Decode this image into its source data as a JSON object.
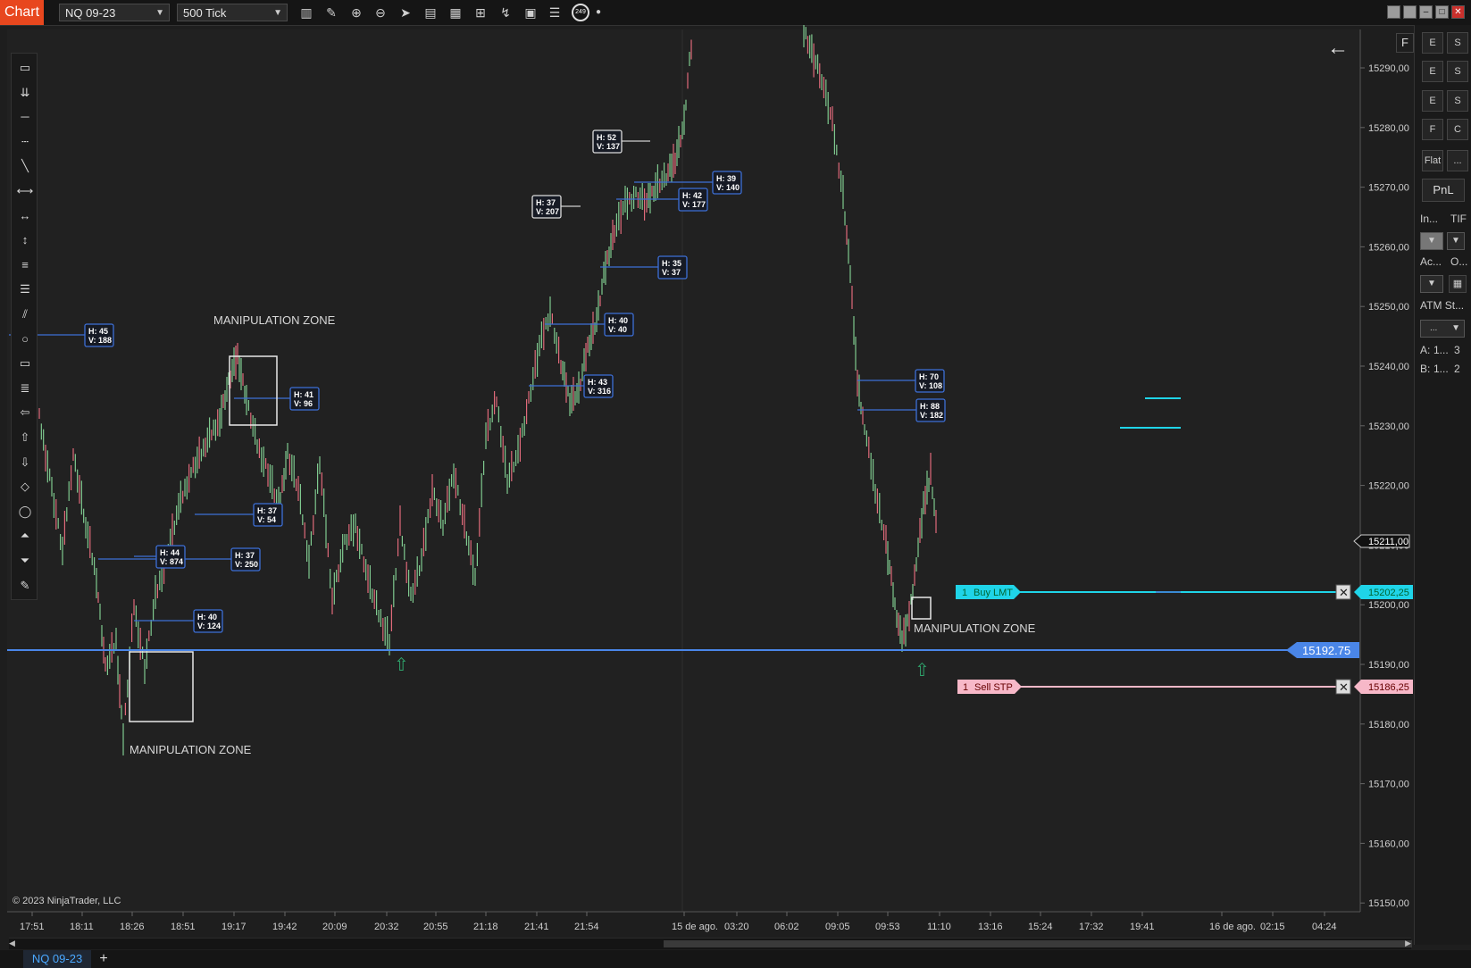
{
  "toolbar": {
    "chart_tab": "Chart",
    "instrument": "NQ 09-23",
    "interval": "500 Tick",
    "counter": "249",
    "icons": [
      "bar-style-icon",
      "pencil-icon",
      "zoom-in-icon",
      "zoom-out-icon",
      "pointer-icon",
      "data-box-icon",
      "properties-icon",
      "snapshot-icon",
      "strategy-icon",
      "template-icon",
      "list-icon"
    ]
  },
  "drawing_tools": [
    "ruler-icon",
    "risk-reward-icon",
    "line-icon",
    "ray-icon",
    "extended-line-icon",
    "arrow-line-icon",
    "horizontal-line-icon",
    "vertical-line-icon",
    "fibonacci-icon",
    "fib-extensions-icon",
    "parallel-channel-icon",
    "ellipse-icon",
    "rectangle-icon",
    "text-icon",
    "arrow-icon",
    "arrow-up-icon",
    "arrow-down-icon",
    "diamond-icon",
    "dot-icon",
    "triangle-up-icon",
    "triangle-down-icon",
    "pen-icon"
  ],
  "copyright": "© 2023 NinjaTrader, LLC",
  "chart": {
    "price_axis": [
      "15290,00",
      "15280,00",
      "15270,00",
      "15260,00",
      "15250,00",
      "15240,00",
      "15230,00",
      "15220,00",
      "15210,00",
      "15200,00",
      "15190,00",
      "15180,00",
      "15170,00",
      "15160,00",
      "15150,00"
    ],
    "time_axis": [
      "17:51",
      "18:11",
      "18:26",
      "18:51",
      "19:17",
      "19:42",
      "20:09",
      "20:32",
      "20:55",
      "21:18",
      "21:41",
      "21:54",
      "15 de ago.",
      "03:20",
      "06:02",
      "09:05",
      "09:53",
      "11:10",
      "13:16",
      "15:24",
      "17:32",
      "19:41",
      "16 de ago.",
      "02:15",
      "04:24"
    ],
    "current_price": "15211,00",
    "level_price": "15192.75",
    "buy_order": {
      "qty": "1",
      "label": "Buy LMT",
      "price": "15202,25"
    },
    "sell_order": {
      "qty": "1",
      "label": "Sell STP",
      "price": "15186,25"
    },
    "zone_label": "MANIPULATION ZONE",
    "hv_boxes": [
      {
        "h": "H: 52",
        "v": "V: 137"
      },
      {
        "h": "H: 37",
        "v": "V: 207"
      },
      {
        "h": "H: 39",
        "v": "V: 140"
      },
      {
        "h": "H: 42",
        "v": "V: 177"
      },
      {
        "h": "H: 35",
        "v": "V: 37"
      },
      {
        "h": "H: 40",
        "v": "V: 40"
      },
      {
        "h": "H: 43",
        "v": "V: 316"
      },
      {
        "h": "H: 45",
        "v": "V: 188"
      },
      {
        "h": "H: 41",
        "v": "V: 96"
      },
      {
        "h": "H: 37",
        "v": "V: 54"
      },
      {
        "h": "H: 37",
        "v": "V: 250"
      },
      {
        "h": "H: 44",
        "v": "V: 874"
      },
      {
        "h": "H: 40",
        "v": "V: 124"
      },
      {
        "h": "H: 70",
        "v": "V: 108"
      },
      {
        "h": "H: 88",
        "v": "V: 182"
      }
    ]
  },
  "side_panel": {
    "grid": [
      "E",
      "S",
      "E",
      "S",
      "E",
      "S",
      "F",
      "C"
    ],
    "flat": "Flat",
    "more": "...",
    "pnl": "PnL",
    "instrument_label": "In...",
    "tif_label": "TIF",
    "account_label": "Ac...",
    "oco_label": "O...",
    "atm_label": "ATM St...",
    "atm_value": "...",
    "ask_label": "A:",
    "ask_value": "1...",
    "ask_qty": "3",
    "bid_label": "B:",
    "bid_value": "1...",
    "bid_qty": "2"
  },
  "bottom": {
    "tab": "NQ 09-23",
    "add": "+"
  }
}
